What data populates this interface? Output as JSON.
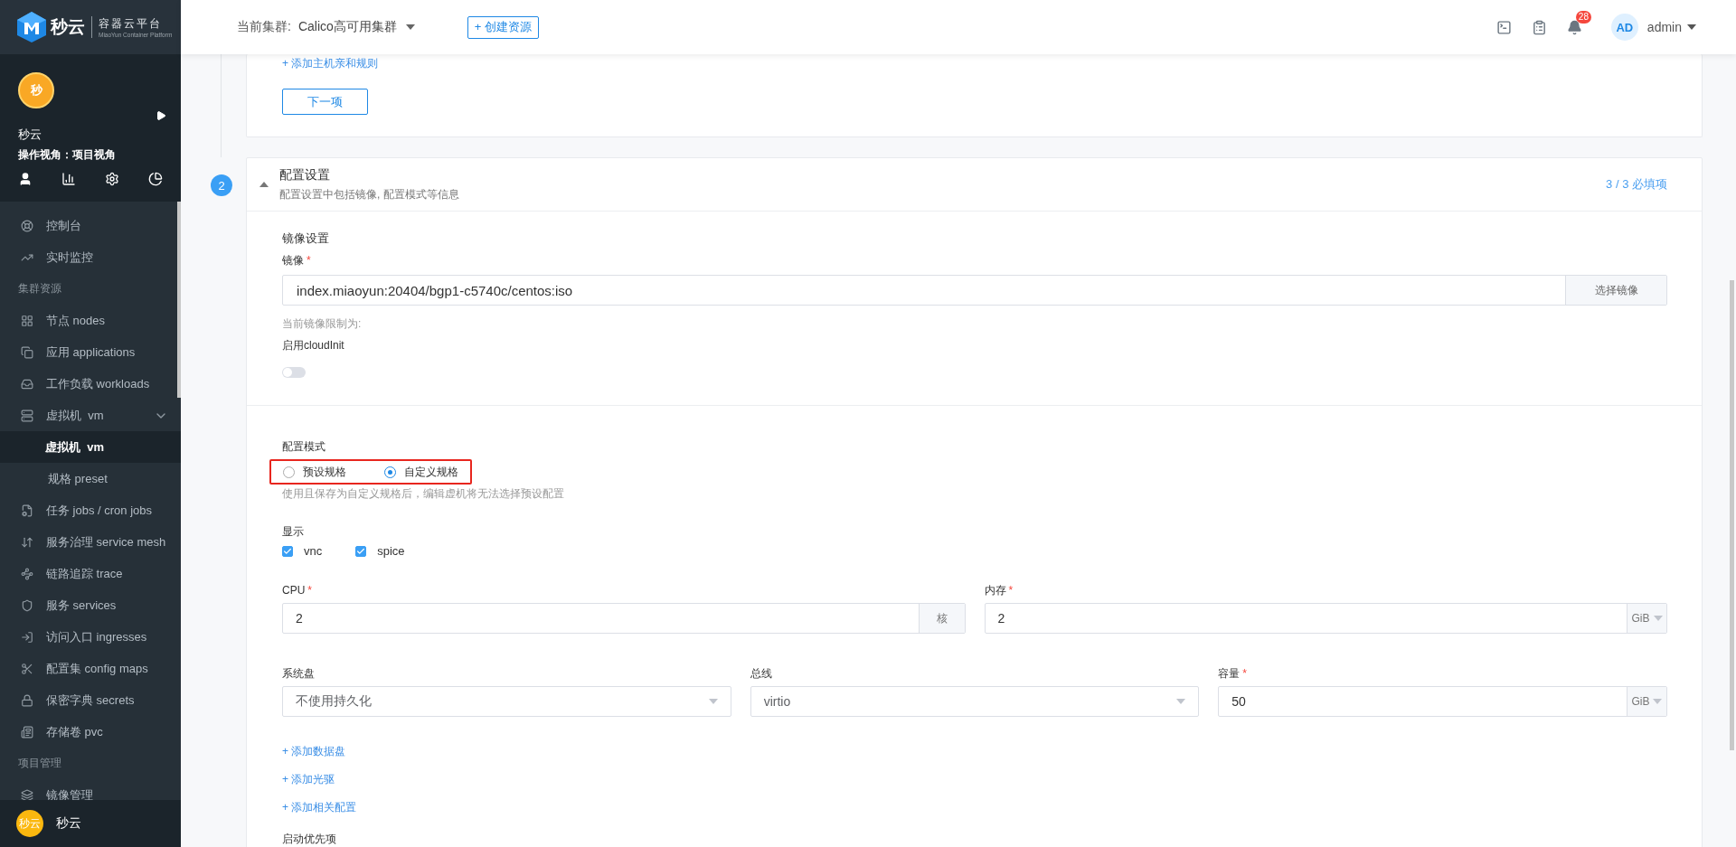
{
  "brand": {
    "name": "秒云",
    "product": "容器云平台",
    "tagline": "MiaoYun Container Platform"
  },
  "project": {
    "avatar": "秒",
    "name": "秒云",
    "view": "操作视角：项目视角"
  },
  "sidebar": {
    "items": [
      {
        "kind": "item",
        "label": "控制台",
        "selected": false
      },
      {
        "kind": "item",
        "label": "实时监控",
        "selected": false
      },
      {
        "kind": "group",
        "label": "集群资源"
      },
      {
        "kind": "item",
        "label": "节点 nodes",
        "selected": false
      },
      {
        "kind": "item",
        "label": "应用 applications",
        "selected": false
      },
      {
        "kind": "item",
        "label": "工作负载 workloads",
        "selected": false
      },
      {
        "kind": "parent",
        "label": "虚拟机  vm",
        "selected": false,
        "expanded": true
      },
      {
        "kind": "sub",
        "label": "虚拟机  vm",
        "selected": true
      },
      {
        "kind": "sub",
        "label": "规格 preset",
        "selected": false
      },
      {
        "kind": "item",
        "label": "任务 jobs / cron jobs",
        "selected": false
      },
      {
        "kind": "item",
        "label": "服务治理 service mesh",
        "selected": false
      },
      {
        "kind": "item",
        "label": "链路追踪 trace",
        "selected": false
      },
      {
        "kind": "item",
        "label": "服务 services",
        "selected": false
      },
      {
        "kind": "item",
        "label": "访问入口 ingresses",
        "selected": false
      },
      {
        "kind": "item",
        "label": "配置集 config maps",
        "selected": false
      },
      {
        "kind": "item",
        "label": "保密字典 secrets",
        "selected": false
      },
      {
        "kind": "item",
        "label": "存储卷 pvc",
        "selected": false
      },
      {
        "kind": "group",
        "label": "项目管理"
      },
      {
        "kind": "item",
        "label": "镜像管理",
        "selected": false
      }
    ]
  },
  "user": {
    "avatar": "秒云",
    "name": "秒云"
  },
  "header": {
    "cluster_label": "当前集群:",
    "cluster": "Calico高可用集群",
    "create_button": "+ 创建资源",
    "notifications": "28",
    "avatar": "AD",
    "username": "admin"
  },
  "affinity_step": {
    "link": "+ 添加主机亲和规则",
    "next_button": "下一项"
  },
  "config_step": {
    "number": "2",
    "expanded": true,
    "title": "配置设置",
    "subtitle": "配置设置中包括镜像, 配置模式等信息",
    "required_count": "3 / 3 必填项",
    "image_section": {
      "title": "镜像设置",
      "label": "镜像",
      "required_mark": "*",
      "value": "index.miaoyun:20404/bgp1-c5740c/centos:iso",
      "button": "选择镜像",
      "hint": "当前镜像限制为:",
      "cloudinit_label": "启用cloudInit",
      "cloudinit_on": false
    },
    "mode": {
      "label": "配置模式",
      "highlighted": true,
      "options": [
        {
          "label": "预设规格",
          "selected": false
        },
        {
          "label": "自定义规格",
          "selected": true
        }
      ],
      "hint": "使用且保存为自定义规格后，编辑虚机将无法选择预设配置"
    },
    "display": {
      "label": "显示",
      "options": [
        {
          "label": "vnc",
          "checked": true
        },
        {
          "label": "spice",
          "checked": true
        }
      ]
    },
    "cpu": {
      "label": "CPU",
      "required_mark": "*",
      "value": "2",
      "unit": "核"
    },
    "memory": {
      "label": "内存",
      "required_mark": "*",
      "value": "2",
      "unit": "GiB"
    },
    "system_disk": {
      "label": "系统盘",
      "value": "不使用持久化"
    },
    "bus": {
      "label": "总线",
      "value": "virtio"
    },
    "capacity": {
      "label": "容量",
      "required_mark": "*",
      "value": "50",
      "unit": "GiB"
    },
    "links": [
      "+ 添加数据盘",
      "+ 添加光驱",
      "+ 添加相关配置"
    ],
    "boot_label": "启动优先项"
  }
}
